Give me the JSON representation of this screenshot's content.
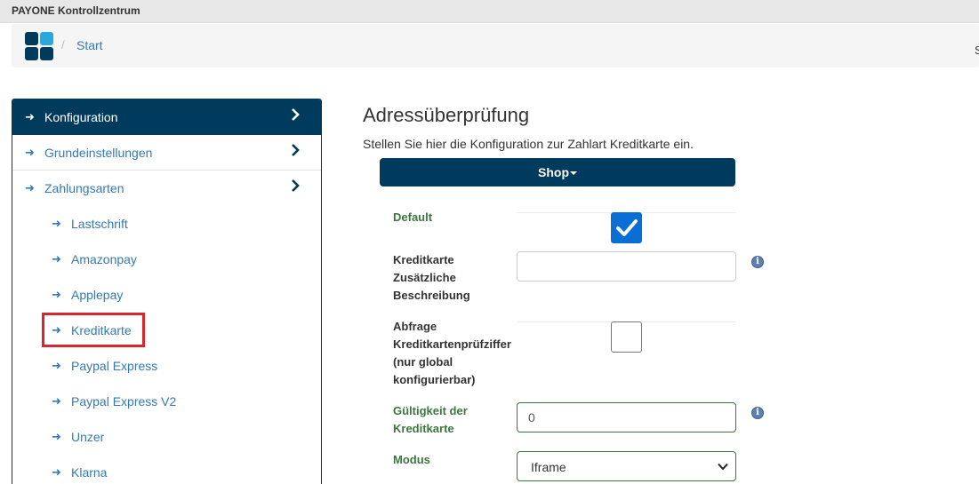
{
  "app": {
    "title": "PAYONE Kontrollzentrum"
  },
  "breadcrumb": {
    "separator": "/",
    "start": "Start",
    "cut_text": "S"
  },
  "sidebar": {
    "arrow": "➜",
    "items": [
      {
        "label": "Konfiguration",
        "active": true,
        "has_chevron": true
      },
      {
        "label": "Grundeinstellungen",
        "has_chevron": true
      },
      {
        "label": "Zahlungsarten",
        "has_chevron": true
      },
      {
        "label": "Lastschrift"
      },
      {
        "label": "Amazonpay"
      },
      {
        "label": "Applepay"
      },
      {
        "label": "Kreditkarte",
        "highlighted": true
      },
      {
        "label": "Paypal Express"
      },
      {
        "label": "Paypal Express V2"
      },
      {
        "label": "Unzer"
      },
      {
        "label": "Klarna"
      }
    ]
  },
  "main": {
    "title": "Adressüberprüfung",
    "description": "Stellen Sie hier die Konfiguration zur Zahlart Kreditkarte ein.",
    "shop_button": "Shop"
  },
  "form": {
    "default_label": "Default",
    "default_checked": true,
    "description_label": "Kreditkarte Zusätzliche Beschreibung",
    "description_value": "",
    "cvc_label": "Abfrage Kreditkartenprüfziffer (nur global konfigurierbar)",
    "cvc_checked": false,
    "validity_label": "Gültigkeit der Kreditkarte",
    "validity_value": "0",
    "mode_label": "Modus",
    "mode_value": "Iframe"
  },
  "colors": {
    "brand": "#003a5d",
    "link": "#337ab7",
    "success": "#3c763d",
    "highlight": "#d9262c",
    "checkbox": "#0a6fd4"
  }
}
